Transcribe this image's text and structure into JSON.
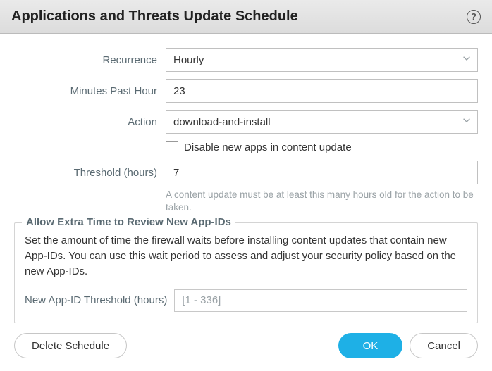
{
  "header": {
    "title": "Applications and Threats Update Schedule"
  },
  "form": {
    "recurrence": {
      "label": "Recurrence",
      "value": "Hourly"
    },
    "minutes_past_hour": {
      "label": "Minutes Past Hour",
      "value": "23"
    },
    "action": {
      "label": "Action",
      "value": "download-and-install"
    },
    "disable_new_apps": {
      "label": "Disable new apps in content update",
      "checked": false
    },
    "threshold": {
      "label": "Threshold (hours)",
      "value": "7",
      "hint": "A content update must be at least this many hours old for the action to be taken."
    }
  },
  "section": {
    "legend": "Allow Extra Time to Review New App-IDs",
    "description": "Set the amount of time the firewall waits before installing content updates that contain new App-IDs. You can use this wait period to assess and adjust your security policy based on the new App-IDs.",
    "new_app_id_threshold": {
      "label": "New App-ID Threshold (hours)",
      "placeholder": "[1 - 336]",
      "value": ""
    }
  },
  "buttons": {
    "delete": "Delete Schedule",
    "ok": "OK",
    "cancel": "Cancel"
  }
}
